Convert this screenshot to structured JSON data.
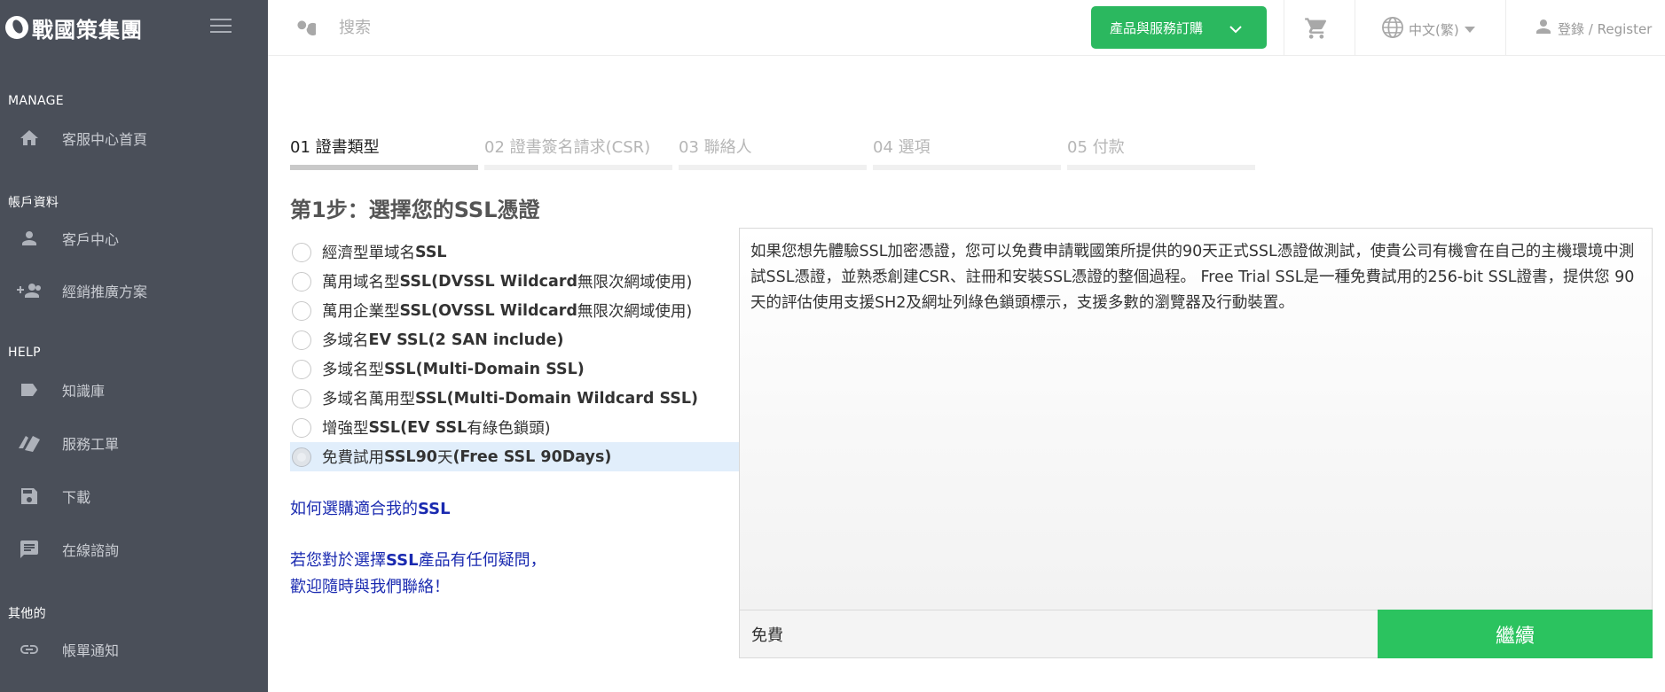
{
  "sidebar": {
    "brand": "戰國策集團",
    "sections": [
      {
        "title": "MANAGE",
        "items": [
          {
            "label": "客服中心首頁",
            "icon": "home-icon"
          }
        ]
      },
      {
        "title": "帳戶資料",
        "items": [
          {
            "label": "客戶中心",
            "icon": "user-icon"
          },
          {
            "label": "經銷推廣方案",
            "icon": "user-add-icon"
          }
        ]
      },
      {
        "title": "HELP",
        "items": [
          {
            "label": "知識庫",
            "icon": "label-icon"
          },
          {
            "label": "服務工單",
            "icon": "ticket-icon"
          },
          {
            "label": "下載",
            "icon": "save-icon"
          },
          {
            "label": "在線諮詢",
            "icon": "chat-icon"
          }
        ]
      },
      {
        "title": "其他的",
        "items": [
          {
            "label": "帳單通知",
            "icon": "link-icon"
          }
        ]
      }
    ]
  },
  "topbar": {
    "search_placeholder": "搜索",
    "order_button": "產品與服務訂購",
    "language": "中文(繁)",
    "login": "登錄 / Register"
  },
  "steps": [
    {
      "label": "01 證書類型",
      "active": true
    },
    {
      "label": "02 證書簽名請求(CSR)",
      "active": false
    },
    {
      "label": "03 聯絡人",
      "active": false
    },
    {
      "label": "04 選項",
      "active": false
    },
    {
      "label": "05 付款",
      "active": false
    }
  ],
  "step_title": "第1步：選擇您的SSL憑證",
  "options": [
    {
      "pre": "經濟型單域名",
      "bold": "SSL",
      "post": ""
    },
    {
      "pre": "萬用域名型",
      "bold": "SSL(DVSSL Wildcard",
      "post": " 無限次網域使用)"
    },
    {
      "pre": "萬用企業型",
      "bold": "SSL(OVSSL Wildcard",
      "post": " 無限次網域使用)"
    },
    {
      "pre": "多域名 ",
      "bold": "EV SSL(2 SAN include)",
      "post": ""
    },
    {
      "pre": "多域名型",
      "bold": "SSL(Multi-Domain SSL)",
      "post": ""
    },
    {
      "pre": "多域名萬用型",
      "bold": "SSL(Multi-Domain Wildcard SSL)",
      "post": ""
    },
    {
      "pre": "增強型",
      "bold": "SSL(EV SSL",
      "post": " 有綠色鎖頭)"
    },
    {
      "pre": "免費試用",
      "bold": "SSL90",
      "post": "天",
      "bold2": "(Free SSL 90Days)",
      "selected": true
    }
  ],
  "help": {
    "link_pre": "如何選購適合我的",
    "link_bold": "SSL",
    "text_line1_pre": "若您對於選擇",
    "text_line1_bold": "SSL",
    "text_line1_post": "產品有任何疑問，",
    "text_line2": "歡迎隨時與我們聯絡！"
  },
  "description": "如果您想先體驗SSL加密憑證，您可以免費申請戰國策所提供的90天正式SSL憑證做測試，使貴公司有機會在自己的主機環境中測試SSL憑證，並熟悉創建CSR、註冊和安裝SSL憑證的整個過程。 Free Trial SSL是一種免費試用的256-bit SSL證書，提供您 90天的評估使用支援SH2及網址列綠色鎖頭標示，支援多數的瀏覽器及行動裝置。",
  "price": "免費",
  "continue_button": "繼續"
}
